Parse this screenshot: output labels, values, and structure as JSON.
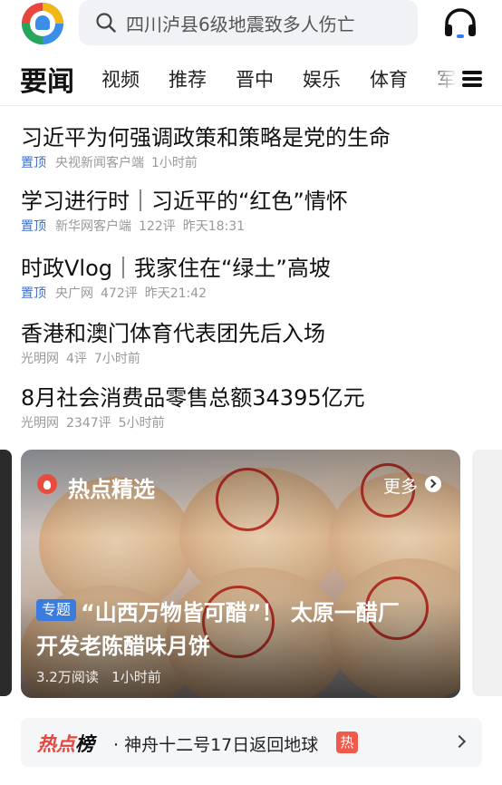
{
  "search": {
    "query": "四川泸县6级地震致多人伤亡"
  },
  "tabs": [
    "要闻",
    "视频",
    "推荐",
    "晋中",
    "娱乐",
    "体育",
    "军"
  ],
  "news": [
    {
      "title": "习近平为何强调政策和策略是党的生命",
      "pinned": "置顶",
      "source": "央视新闻客户端",
      "comments": "",
      "time": "1小时前"
    },
    {
      "title": "学习进行时｜习近平的“红色”情怀",
      "pinned": "置顶",
      "source": "新华网客户端",
      "comments": "122评",
      "time": "昨天18:31"
    },
    {
      "title": "时政Vlog｜我家住在“绿土”高坡",
      "pinned": "置顶",
      "source": "央广网",
      "comments": "472评",
      "time": "昨天21:42"
    },
    {
      "title": "香港和澳门体育代表团先后入场",
      "pinned": "",
      "source": "光明网",
      "comments": "4评",
      "time": "7小时前"
    },
    {
      "title": "8月社会消费品零售总额34395亿元",
      "pinned": "",
      "source": "光明网",
      "comments": "2347评",
      "time": "5小时前"
    }
  ],
  "hot_card": {
    "section_title": "热点精选",
    "more_label": "更多",
    "tag": "专题",
    "headline_line1": "“山西万物皆可醋”！  太原一醋厂",
    "headline_line2": "开发老陈醋味月饼",
    "reads": "3.2万阅读",
    "time": "1小时前"
  },
  "hot_rank": {
    "label_prefix": "热点",
    "label_suffix": "榜",
    "item": "· 神舟十二号17日返回地球",
    "badge": "热"
  },
  "icons": {
    "search": "search-icon",
    "headset": "headset-icon",
    "menu": "menu-icon",
    "flame": "flame-icon",
    "more": "chevron-right-circle-icon",
    "rank_arrow": "chevron-right-icon"
  },
  "colors": {
    "pin_blue": "#3e6fc7",
    "tag_blue": "#3a7bde",
    "hot_red": "#e8453c"
  }
}
